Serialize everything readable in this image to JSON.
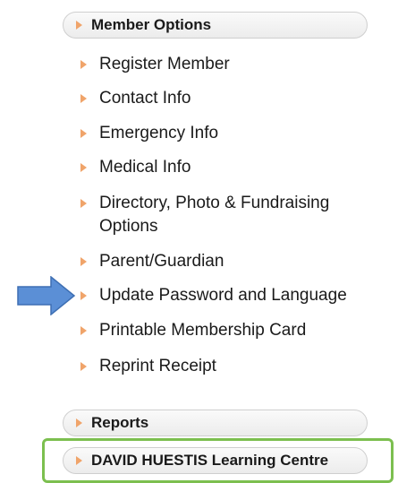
{
  "sections": {
    "member_options": "Member Options",
    "reports": "Reports",
    "learning_centre": "DAVID HUESTIS Learning Centre"
  },
  "menu": {
    "items": [
      "Register Member",
      "Contact Info",
      "Emergency Info",
      "Medical Info",
      "Directory, Photo & Fundraising Options",
      "Parent/Guardian",
      "Update Password and Language",
      "Printable Membership Card",
      "Reprint Receipt"
    ]
  },
  "colors": {
    "bullet": "#f0a46a",
    "pointer_arrow": "#5b8fd6",
    "highlight_box": "#7cbf4f"
  },
  "icons": {
    "bullet": "triangle-right-icon",
    "pointer": "blue-arrow-icon"
  }
}
